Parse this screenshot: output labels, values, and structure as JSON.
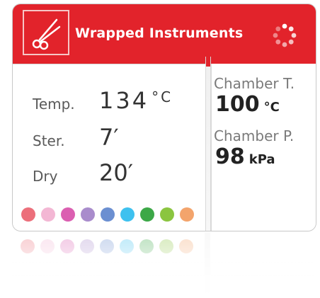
{
  "header": {
    "title": "Wrapped Instruments",
    "bg_color": "#e2232b",
    "program_icon": "scissors-icon",
    "status_icon": "spinner-icon"
  },
  "cycle": {
    "temp": {
      "label": "Temp.",
      "value": "134",
      "unit": "°C"
    },
    "ster": {
      "label": "Ster.",
      "value": "7′"
    },
    "dry": {
      "label": "Dry",
      "value": "20′"
    }
  },
  "chamber": {
    "temp": {
      "label": "Chamber T.",
      "value": "100",
      "unit": "°C"
    },
    "pressure": {
      "label": "Chamber P.",
      "value": "98",
      "unit": "kPa"
    }
  },
  "progress_dots": [
    {
      "color": "#ec6f7b"
    },
    {
      "color": "#f3b7d4"
    },
    {
      "color": "#db5fb1"
    },
    {
      "color": "#a98ccc"
    },
    {
      "color": "#6b8fd1"
    },
    {
      "color": "#3ec1ef"
    },
    {
      "color": "#3ca847"
    },
    {
      "color": "#8bc540"
    },
    {
      "color": "#f3a46c"
    }
  ]
}
